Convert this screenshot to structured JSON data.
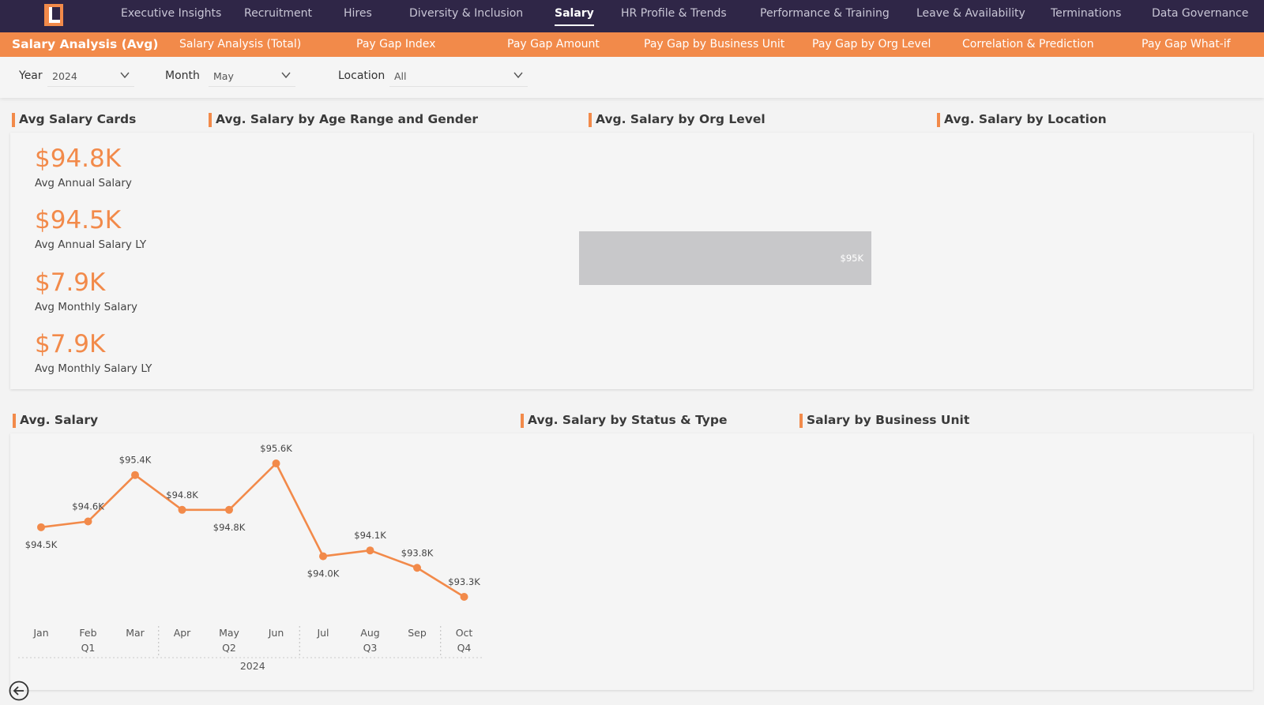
{
  "topnav": {
    "items": [
      "Executive Insights",
      "Recruitment",
      "Hires",
      "Diversity & Inclusion",
      "Salary",
      "HR Profile & Trends",
      "Performance & Training",
      "Leave & Availability",
      "Terminations",
      "Data Governance"
    ],
    "active": "Salary"
  },
  "subnav": {
    "items": [
      "Salary Analysis (Avg)",
      "Salary Analysis (Total)",
      "Pay Gap Index",
      "Pay Gap Amount",
      "Pay Gap by Business Unit",
      "Pay Gap by Org Level",
      "Correlation & Prediction",
      "Pay Gap What-if"
    ],
    "active": "Salary Analysis (Avg)"
  },
  "filters": {
    "year_label": "Year",
    "year_value": "2024",
    "month_label": "Month",
    "month_value": "May",
    "location_label": "Location",
    "location_value": "All"
  },
  "sections": {
    "cards": "Avg Salary Cards",
    "age_gender": "Avg. Salary by Age Range and Gender",
    "org_level": "Avg. Salary by Org Level",
    "location": "Avg. Salary by Location",
    "avg_salary": "Avg. Salary",
    "status_type": "Avg. Salary by Status & Type",
    "business_unit": "Salary by Business Unit"
  },
  "kpis": [
    {
      "value": "$94.8K",
      "label": "Avg Annual Salary"
    },
    {
      "value": "$94.5K",
      "label": "Avg Annual Salary LY"
    },
    {
      "value": "$7.9K",
      "label": "Avg Monthly Salary"
    },
    {
      "value": "$7.9K",
      "label": "Avg Monthly Salary LY"
    }
  ],
  "colors": {
    "accent": "#f28a4a",
    "nav_bg": "#2f2647",
    "bar_gray": "#c8c8ca"
  },
  "chart_data": [
    {
      "type": "bar",
      "title": "Avg. Salary by Org Level",
      "orientation": "horizontal",
      "categories": [
        ""
      ],
      "values": [
        95
      ],
      "data_labels": [
        "$95K"
      ]
    },
    {
      "type": "line",
      "title": "Avg. Salary",
      "x": [
        "Jan",
        "Feb",
        "Mar",
        "Apr",
        "May",
        "Jun",
        "Jul",
        "Aug",
        "Sep",
        "Oct"
      ],
      "values": [
        94.5,
        94.6,
        95.4,
        94.8,
        94.8,
        95.6,
        94.0,
        94.1,
        93.8,
        93.3
      ],
      "data_labels": [
        "$94.5K",
        "$94.6K",
        "$95.4K",
        "$94.8K",
        "$94.8K",
        "$95.6K",
        "$94.0K",
        "$94.1K",
        "$93.8K",
        "$93.3K"
      ],
      "quarters": [
        "Q1",
        "Q2",
        "Q3",
        "Q4"
      ],
      "year": "2024",
      "grid": false
    }
  ]
}
